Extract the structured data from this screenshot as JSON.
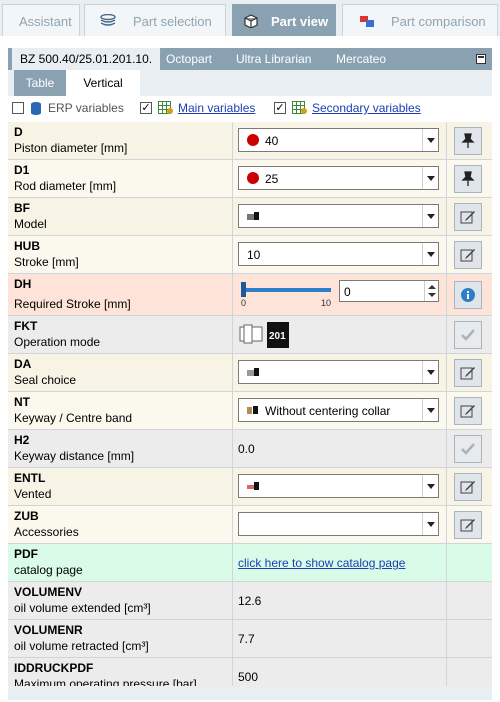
{
  "top_tabs": [
    "Assistant",
    "Part selection",
    "Part view",
    "Part comparison"
  ],
  "sub_tabs": [
    "BZ 500.40/25.01.201.10.",
    "Octopart",
    "Ultra Librarian",
    "Mercateo"
  ],
  "view_tabs": [
    "Table",
    "Vertical"
  ],
  "checks": {
    "erp": {
      "label": "ERP variables",
      "checked": false
    },
    "main": {
      "label": "Main variables",
      "checked": true
    },
    "secondary": {
      "label": "Secondary variables",
      "checked": true
    }
  },
  "rows": [
    {
      "code": "D",
      "desc": "Piston diameter [mm]",
      "value": "40"
    },
    {
      "code": "D1",
      "desc": "Rod diameter [mm]",
      "value": "25"
    },
    {
      "code": "BF",
      "desc": "Model",
      "value": ""
    },
    {
      "code": "HUB",
      "desc": "Stroke [mm]",
      "value": "10"
    },
    {
      "code": "DH",
      "desc": "Required Stroke [mm]",
      "value": "0",
      "slider_min": "0",
      "slider_max": "10"
    },
    {
      "code": "FKT",
      "desc": "Operation mode",
      "value": "201"
    },
    {
      "code": "DA",
      "desc": "Seal choice",
      "value": ""
    },
    {
      "code": "NT",
      "desc": "Keyway / Centre band",
      "value": "Without centering collar"
    },
    {
      "code": "H2",
      "desc": "Keyway distance [mm]",
      "value": "0.0"
    },
    {
      "code": "ENTL",
      "desc": "Vented",
      "value": ""
    },
    {
      "code": "ZUB",
      "desc": "Accessories",
      "value": ""
    },
    {
      "code": "PDF",
      "desc": "catalog page",
      "value": "click here to show catalog page"
    },
    {
      "code": "VOLUMENV",
      "desc": "oil volume extended [cm³]",
      "value": "12.6"
    },
    {
      "code": "VOLUMENR",
      "desc": "oil volume retracted [cm³]",
      "value": "7.7"
    },
    {
      "code": "IDDRUCKPDF",
      "desc": "Maximum operating pressure [bar]",
      "value": "500"
    }
  ],
  "colors": {
    "accent": "#8aa1b1",
    "pin_red": "#cc0000",
    "link": "#1a3fb5"
  }
}
